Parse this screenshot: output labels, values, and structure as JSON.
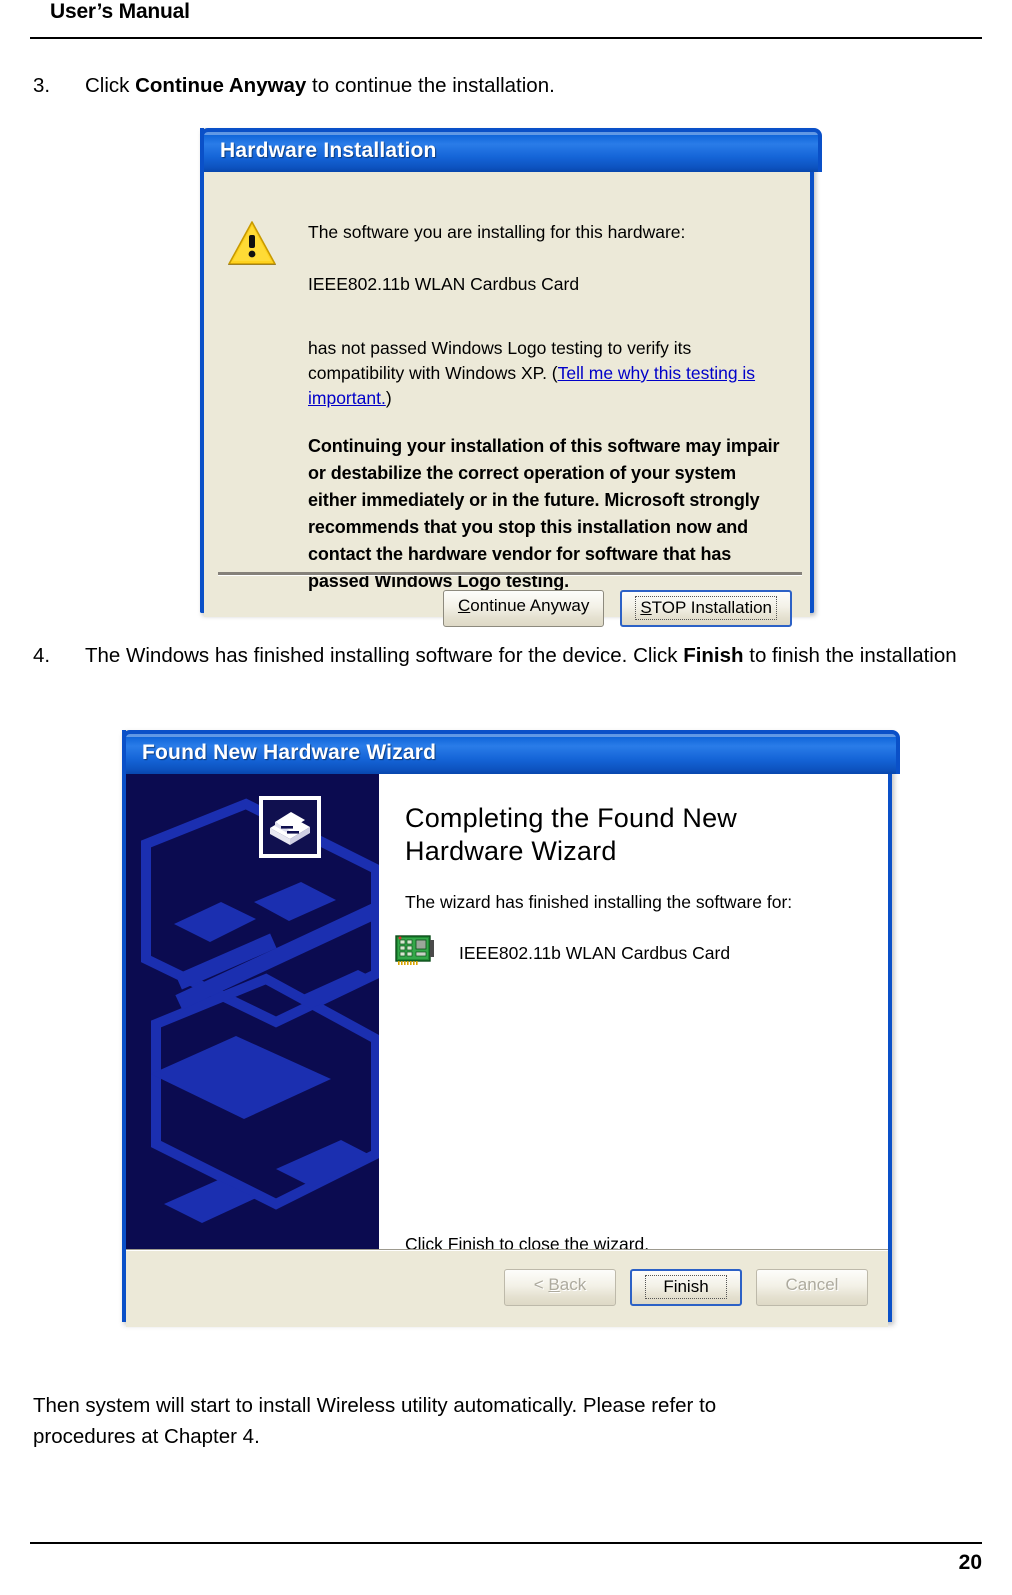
{
  "header": {
    "title": "User’s Manual"
  },
  "steps": [
    {
      "number": "3.",
      "text_before": "Click ",
      "bold": "Continue Anyway",
      "text_after": " to continue the installation."
    },
    {
      "number": "4.",
      "text_before": "The Windows has finished installing software for the device. Click ",
      "bold": "Finish",
      "text_after": " to finish the installation"
    }
  ],
  "hardware_installation_dialog": {
    "title": "Hardware Installation",
    "icon": "warning-triangle-icon",
    "intro_line": "The software you are installing for this hardware:",
    "device_name": "IEEE802.11b WLAN Cardbus Card",
    "compat_text_1": "has not passed Windows Logo testing to verify its compatibility with Windows XP. (",
    "compat_link": "Tell me why this testing is important.",
    "compat_text_2": ")",
    "warning_paragraph": "Continuing your installation of this software may impair or destabilize the correct operation of your system either immediately or in the future. Microsoft strongly recommends that you stop this installation now and contact the hardware vendor for software that has passed Windows Logo testing.",
    "buttons": {
      "continue_accel": "C",
      "continue_rest": "ontinue Anyway",
      "stop_accel": "S",
      "stop_rest": "TOP Installation"
    }
  },
  "found_new_hardware_wizard": {
    "title": "Found New Hardware Wizard",
    "sidebar_icon": "computer-device-icon",
    "heading": "Completing the Found New Hardware Wizard",
    "subtitle": "The wizard has finished installing the software for:",
    "device_icon": "network-card-icon",
    "device_name": "IEEE802.11b WLAN Cardbus Card",
    "footnote": "Click Finish to close the wizard.",
    "buttons": {
      "back_prefix": "< ",
      "back_accel": "B",
      "back_rest": "ack",
      "finish": "Finish",
      "cancel": "Cancel"
    }
  },
  "closing_paragraph": {
    "line1": "Then system will start to install Wireless utility automatically. Please refer to",
    "line2": "procedures at Chapter 4."
  },
  "footer": {
    "page_number": "20"
  },
  "colors": {
    "title_bar_blue": "#0a50c8",
    "dialog_face": "#ece9d8",
    "wizard_sidebar": "#0b0b50",
    "link_blue": "#0000c8",
    "warning_yellow": "#ffd21e"
  }
}
